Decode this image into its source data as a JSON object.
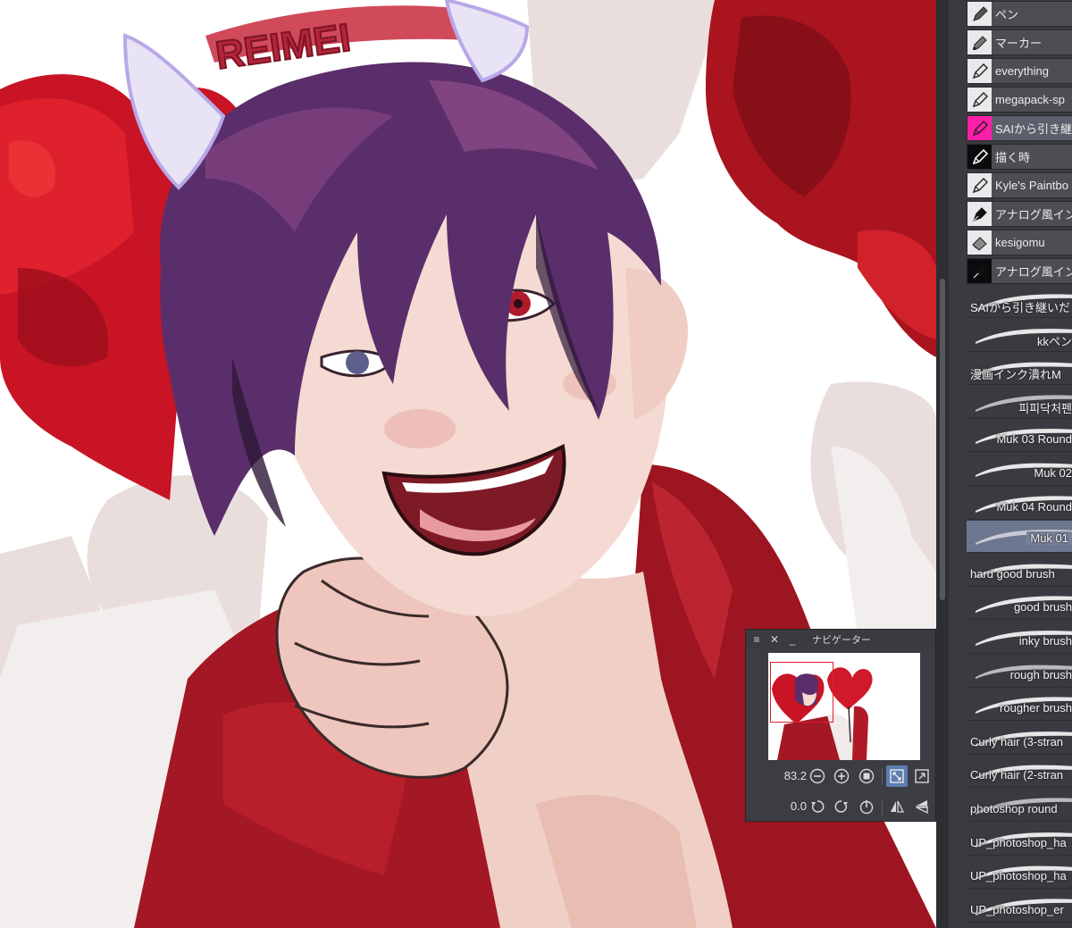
{
  "brush_panel": {
    "tools": [
      {
        "label": "ペン",
        "icon": "pen-icon",
        "style": "light",
        "selected": false
      },
      {
        "label": "マーカー",
        "icon": "marker-icon",
        "style": "light",
        "selected": false
      },
      {
        "label": "everything",
        "icon": "pen-outline-icon",
        "style": "light",
        "selected": false
      },
      {
        "label": "megapack-sp",
        "icon": "pen-outline-icon",
        "style": "light",
        "selected": false
      },
      {
        "label": "SAIから引き継",
        "icon": "pen-outline-icon",
        "style": "pink",
        "selected": true
      },
      {
        "label": "描く時",
        "icon": "pen-white-icon",
        "style": "dark",
        "selected": false
      },
      {
        "label": "Kyle's Paintbo",
        "icon": "pen-outline-icon",
        "style": "light",
        "selected": false
      },
      {
        "label": "アナログ風イン",
        "icon": "fountain-pen-icon",
        "style": "light-dark",
        "selected": false
      },
      {
        "label": "kesigomu",
        "icon": "eraser-icon",
        "style": "light",
        "selected": false
      },
      {
        "label": "アナログ風イン",
        "icon": "fountain-pen-icon",
        "style": "dark",
        "selected": false
      }
    ],
    "brushes": [
      {
        "label": "SAIから引き継いだ",
        "align": "left",
        "selected": false
      },
      {
        "label": "kkペン",
        "align": "right",
        "selected": false
      },
      {
        "label": "漫画インク潰れM",
        "align": "left",
        "selected": false
      },
      {
        "label": "피피닥처펜",
        "align": "right",
        "selected": false
      },
      {
        "label": "Muk 03 Round",
        "align": "right",
        "selected": false
      },
      {
        "label": "Muk 02",
        "align": "right",
        "selected": false
      },
      {
        "label": "Muk 04 Round",
        "align": "right",
        "selected": false
      },
      {
        "label": "Muk 01",
        "align": "right",
        "selected": true
      },
      {
        "label": "hard good brush",
        "align": "left",
        "selected": false
      },
      {
        "label": "good brush",
        "align": "right",
        "selected": false
      },
      {
        "label": "inky brush",
        "align": "right",
        "selected": false
      },
      {
        "label": "rough brush",
        "align": "right",
        "selected": false
      },
      {
        "label": "rougher brush",
        "align": "right",
        "selected": false
      },
      {
        "label": "Curly hair (3-stran",
        "align": "left",
        "selected": false
      },
      {
        "label": "Curly hair (2-stran",
        "align": "left",
        "selected": false
      },
      {
        "label": "photoshop round",
        "align": "left",
        "selected": false
      },
      {
        "label": "UP_photoshop_ha",
        "align": "left",
        "selected": false
      },
      {
        "label": "UP_photoshop_ha",
        "align": "left",
        "selected": false
      },
      {
        "label": "UP_photoshop_er",
        "align": "left",
        "selected": false
      }
    ]
  },
  "navigator": {
    "title": "ナビゲーター",
    "zoom_value": "83.2",
    "rotation_value": "0.0",
    "icons": {
      "menu": "menu-icon",
      "close": "close-icon",
      "minimize": "minimize-icon",
      "zoom_out": "zoom-out-icon",
      "zoom_in": "zoom-in-icon",
      "actual_size": "actual-size-icon",
      "fit_page": "fit-page-icon",
      "fit_window": "fit-window-icon",
      "rotate_left": "rotate-left-icon",
      "rotate_right": "rotate-right-icon",
      "reset_rotation": "reset-rotation-icon",
      "flip_horizontal": "flip-horizontal-icon",
      "flip_vertical": "flip-vertical-icon"
    }
  },
  "artwork": {
    "headband_text": "REIMEI",
    "colors": {
      "hair": "#5a2e6a",
      "skin": "#f3d9d2",
      "jacket": "#a31824",
      "balloon": "#c01020",
      "horn": "#e8e4f5"
    }
  }
}
